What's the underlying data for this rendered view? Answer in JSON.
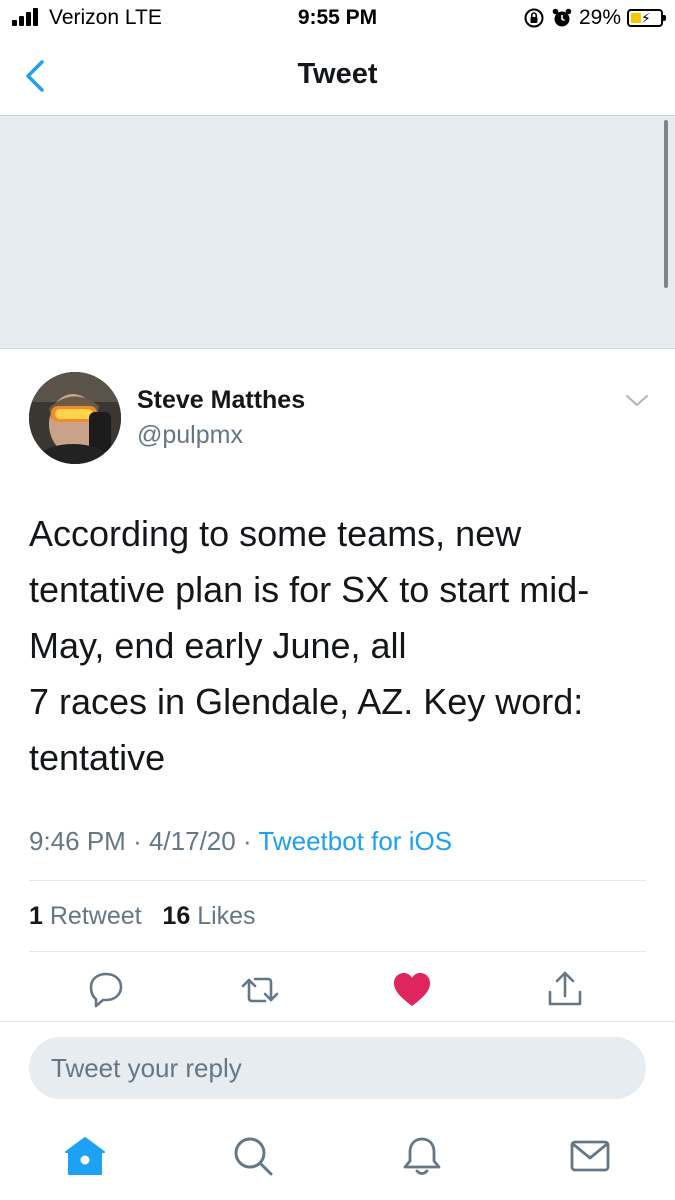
{
  "status_bar": {
    "carrier": "Verizon  LTE",
    "time": "9:55 PM",
    "battery_percent": "29%",
    "icons": [
      "signal-icon",
      "orientation-lock-icon",
      "alarm-icon",
      "battery-charging-icon"
    ]
  },
  "nav": {
    "title": "Tweet",
    "back_icon": "chevron-left-icon"
  },
  "tweet": {
    "author_name": "Steve Matthes",
    "handle": "@pulpmx",
    "text_lines": [
      "According to some teams, new",
      "tentative plan is for SX to start mid-",
      "May, end early June, all",
      "7 races in Glendale, AZ. Key word:",
      "tentative"
    ],
    "time": "9:46 PM",
    "separator": "·",
    "date": "4/17/20",
    "source": "Tweetbot for iOS",
    "retweet_count": "1",
    "retweet_label": "Retweet",
    "like_count": "16",
    "like_label": "Likes",
    "liked": true
  },
  "actions": [
    "reply-icon",
    "retweet-icon",
    "like-heart-icon",
    "share-icon"
  ],
  "reply": {
    "placeholder": "Tweet your reply"
  },
  "tabbar": [
    "home-icon",
    "search-icon",
    "notifications-bell-icon",
    "messages-mail-icon"
  ],
  "colors": {
    "accent": "#1da1f2",
    "like": "#e0245e",
    "secondary_text": "#657786",
    "media_placeholder": "#e6ecf0"
  }
}
